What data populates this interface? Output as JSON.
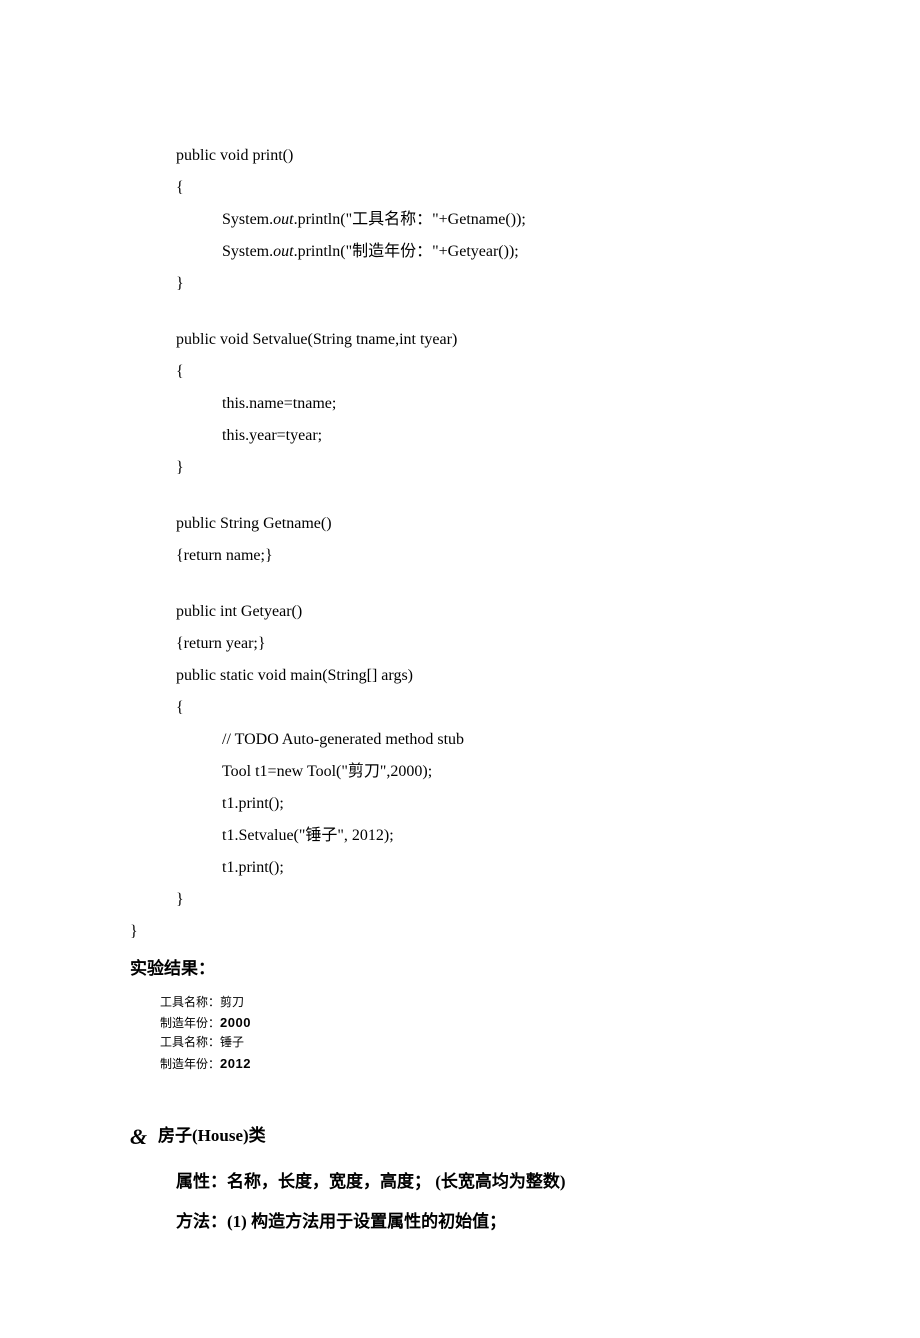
{
  "code": {
    "l1": "public void print()",
    "l2": "{",
    "l3a": "System.",
    "l3b": "out",
    "l3c": ".println(\"工具名称：\"+Getname());",
    "l4a": "System.",
    "l4b": "out",
    "l4c": ".println(\"制造年份：\"+Getyear());",
    "l5": "}",
    "l6": "public void Setvalue(String tname,int tyear)",
    "l7": "{",
    "l8": "this.name=tname;",
    "l9": "this.year=tyear;",
    "l10": "}",
    "l11": "public String Getname()",
    "l12": "{return name;}",
    "l13": "public int Getyear()",
    "l14": "{return year;}",
    "l15": "public static void main(String[] args)",
    "l16": "{",
    "l17": "// TODO Auto-generated method stub",
    "l18": "Tool t1=new Tool(\"剪刀\",2000);",
    "l19": "t1.print();",
    "l20": "t1.Setvalue(\"锤子\", 2012);",
    "l21": "t1.print();",
    "l22": "}",
    "l23": "}"
  },
  "result_heading": "实验结果：",
  "console": {
    "r1a": "工具名称：",
    "r1b": "剪刀",
    "r2a": "制造年份：",
    "r2b": "2000",
    "r3a": "工具名称：",
    "r3b": "锤子",
    "r4a": "制造年份：",
    "r4b": "2012"
  },
  "hand": "&",
  "section_title": "房子(House)类",
  "prop1": "属性：名称，长度，宽度，高度；  (长宽高均为整数)",
  "prop2": "方法：(1) 构造方法用于设置属性的初始值；"
}
